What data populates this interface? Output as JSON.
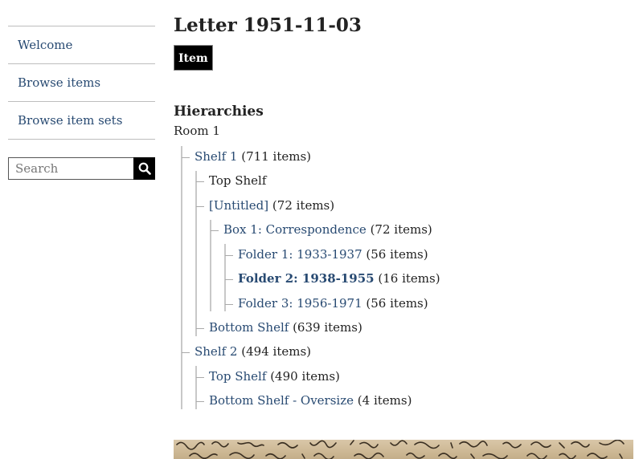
{
  "sidebar": {
    "nav": [
      {
        "label": "Welcome"
      },
      {
        "label": "Browse items"
      },
      {
        "label": "Browse item sets"
      }
    ],
    "search": {
      "placeholder": "Search"
    }
  },
  "main": {
    "title": "Letter 1951-11-03",
    "badge": "Item",
    "hierarchies_heading": "Hierarchies",
    "root": "Room 1",
    "tree": [
      {
        "label": "Shelf 1",
        "count": "(711 items)",
        "link": true
      },
      {
        "label": "Top Shelf",
        "count": "",
        "link": false
      },
      {
        "label": "[Untitled]",
        "count": "(72 items)",
        "link": true
      },
      {
        "label": "Box 1: Correspondence",
        "count": "(72 items)",
        "link": true
      },
      {
        "label": "Folder 1: 1933-1937",
        "count": "(56 items)",
        "link": true
      },
      {
        "label": "Folder 2: 1938-1955",
        "count": "(16 items)",
        "link": true,
        "current": true
      },
      {
        "label": "Folder 3: 1956-1971",
        "count": "(56 items)",
        "link": true
      },
      {
        "label": "Bottom Shelf",
        "count": "(639 items)",
        "link": true
      },
      {
        "label": "Shelf 2",
        "count": "(494 items)",
        "link": true
      },
      {
        "label": "Top Shelf",
        "count": "(490 items)",
        "link": true
      },
      {
        "label": "Bottom Shelf - Oversize",
        "count": "(4 items)",
        "link": true
      }
    ]
  },
  "icons": {
    "search": "search-icon"
  },
  "colors": {
    "link": "#284a72",
    "badge_bg": "#000000"
  }
}
